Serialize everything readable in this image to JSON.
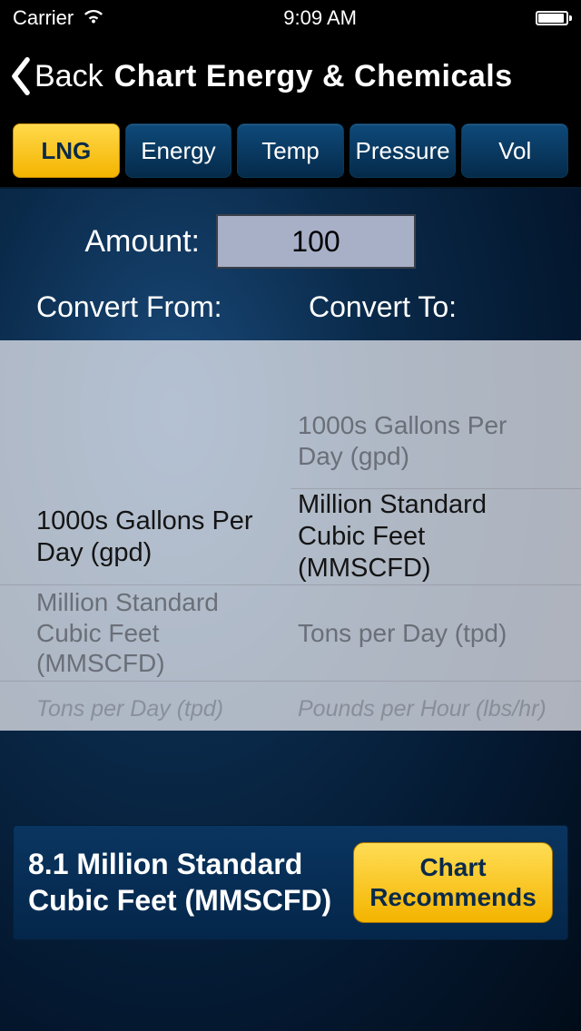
{
  "status": {
    "carrier": "Carrier",
    "time": "9:09 AM"
  },
  "nav": {
    "back_label": "Back",
    "title": "Chart Energy & Chemicals"
  },
  "tabs": [
    {
      "label": "LNG",
      "active": true
    },
    {
      "label": "Energy",
      "active": false
    },
    {
      "label": "Temp",
      "active": false
    },
    {
      "label": "Pressure",
      "active": false
    },
    {
      "label": "Vol",
      "active": false
    }
  ],
  "amount": {
    "label": "Amount:",
    "value": "100"
  },
  "convert": {
    "from_label": "Convert From:",
    "to_label": "Convert To:"
  },
  "picker_from": {
    "items": [
      "",
      "1000s Gallons Per Day (gpd)",
      "Million Standard Cubic Feet (MMSCFD)",
      "Tons per Day (tpd)"
    ],
    "selected_index": 1
  },
  "picker_to": {
    "items": [
      "1000s Gallons Per Day (gpd)",
      "Million Standard Cubic Feet (MMSCFD)",
      "Tons per Day (tpd)",
      "Pounds per Hour (lbs/hr)"
    ],
    "selected_index": 1
  },
  "result": {
    "text": "8.1 Million Standard Cubic Feet (MMSCFD)",
    "button": "Chart Recommends"
  }
}
